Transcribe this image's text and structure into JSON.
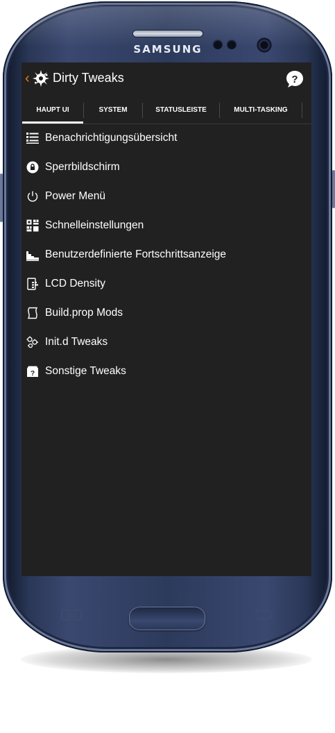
{
  "device": {
    "brand": "SAMSUNG"
  },
  "app": {
    "title": "Dirty Tweaks",
    "back_icon": "back-caret-icon",
    "logo_icon": "splat-logo-icon",
    "help_icon": "help-bubble-icon"
  },
  "tabs": [
    {
      "label": "HAUPT UI",
      "selected": true
    },
    {
      "label": "SYSTEM",
      "selected": false
    },
    {
      "label": "STATUSLEISTE",
      "selected": false
    },
    {
      "label": "MULTI-TASKING",
      "selected": false
    }
  ],
  "menu": {
    "items": [
      {
        "label": "Benachrichtigungsübersicht",
        "icon": "notification-list-icon"
      },
      {
        "label": "Sperrbildschirm",
        "icon": "lock-icon"
      },
      {
        "label": "Power Menü",
        "icon": "power-icon"
      },
      {
        "label": "Schnelleinstellungen",
        "icon": "quick-settings-icon"
      },
      {
        "label": "Benutzerdefinierte Fortschrittsanzeige",
        "icon": "progress-bar-icon"
      },
      {
        "label": "LCD Density",
        "icon": "density-icon"
      },
      {
        "label": "Build.prop Mods",
        "icon": "script-icon"
      },
      {
        "label": "Init.d Tweaks",
        "icon": "gears-icon"
      },
      {
        "label": "Sonstige Tweaks",
        "icon": "misc-box-icon"
      }
    ]
  },
  "colors": {
    "background": "#212121",
    "text": "#ffffff",
    "accent": "#e67e22"
  }
}
